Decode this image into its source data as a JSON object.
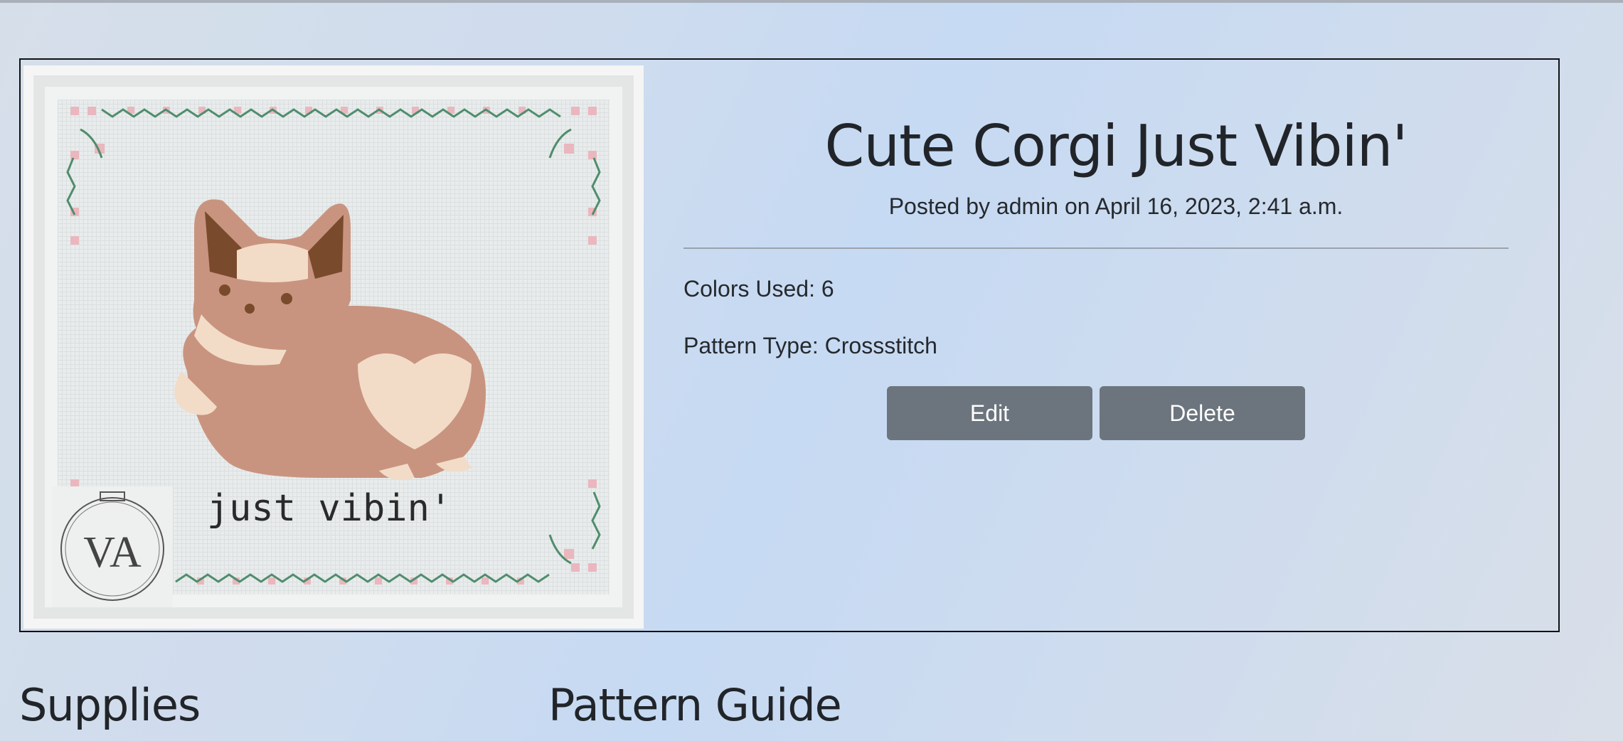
{
  "pattern": {
    "title": "Cute Corgi Just Vibin'",
    "meta": "Posted by admin on April 16, 2023, 2:41 a.m.",
    "colors_used": "Colors Used: 6",
    "pattern_type": "Pattern Type: Crossstitch",
    "image": {
      "caption": "just vibin'",
      "logo_text": "VA"
    }
  },
  "actions": {
    "edit_label": "Edit",
    "delete_label": "Delete"
  },
  "sections": {
    "supplies_heading": "Supplies",
    "guide_heading": "Pattern Guide"
  },
  "colors": {
    "button": "#6c757d",
    "corgi_tan": "#c9947f",
    "corgi_cream": "#f2dcc8",
    "ear_inner": "#7a4a2c",
    "border_pink": "#eab7be",
    "border_green": "#4f8d6d"
  }
}
